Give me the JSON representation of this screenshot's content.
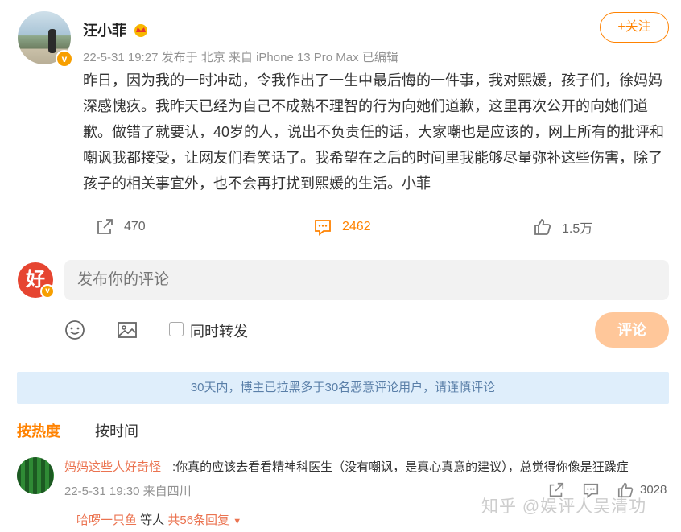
{
  "post": {
    "username": "汪小菲",
    "meta": "22-5-31 19:27  发布于 北京  来自 iPhone 13 Pro Max 已编辑",
    "follow_label": "+关注",
    "text": "昨日，因为我的一时冲动，令我作出了一生中最后悔的一件事，我对熙媛，孩子们，徐妈妈深感愧疚。我昨天已经为自己不成熟不理智的行为向她们道歉，这里再次公开的向她们道歉。做错了就要认，40岁的人，说出不负责任的话，大家嘲也是应该的，网上所有的批评和嘲讽我都接受，让网友们看笑话了。我希望在之后的时间里我能够尽量弥补这些伤害，除了孩子的相关事宜外，也不会再打扰到熙媛的生活。小菲",
    "repost_count": "470",
    "comment_count": "2462",
    "like_count": "1.5万"
  },
  "composer": {
    "avatar_char": "好",
    "placeholder": "发布你的评论",
    "repost_label": "同时转发",
    "submit_label": "评论"
  },
  "notice": "30天内，博主已拉黑多于30名恶意评论用户，请谨慎评论",
  "sort": {
    "hot": "按热度",
    "time": "按时间"
  },
  "comment": {
    "user": "妈妈这些人好奇怪",
    "text": ":你真的应该去看看精神科医生（没有嘲讽，是真心真意的建议），总觉得你像是狂躁症",
    "meta": "22-5-31 19:30 来自四川",
    "like_count": "3028",
    "reply_user": "哈啰一只鱼",
    "reply_mid": " 等人 ",
    "reply_count": "共56条回复"
  },
  "watermark": "知乎 @娱评人吴清功",
  "colors": {
    "accent": "#ff8200",
    "link": "#eb7350",
    "notice_bg": "#dfeefb",
    "submit_disabled": "#ffc79a"
  }
}
